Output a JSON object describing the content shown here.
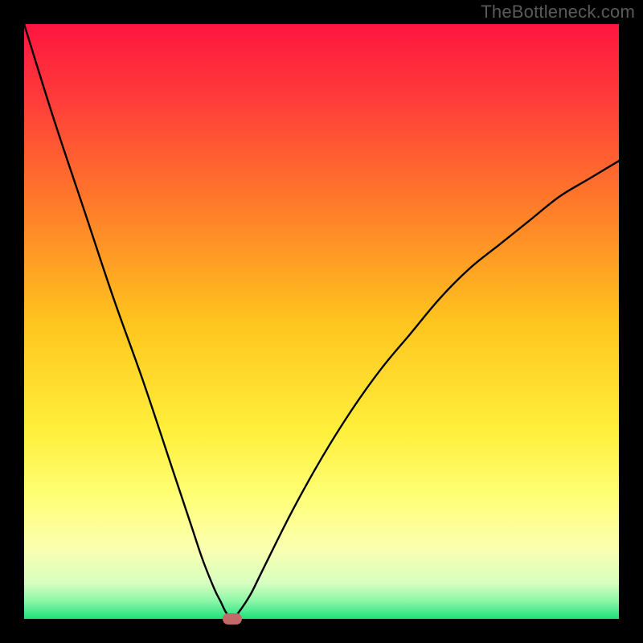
{
  "watermark": "TheBottleneck.com",
  "chart_data": {
    "type": "line",
    "title": "",
    "xlabel": "",
    "ylabel": "",
    "xlim": [
      0,
      100
    ],
    "ylim": [
      0,
      100
    ],
    "grid": false,
    "legend": false,
    "gradient_colors": [
      "#ff1a3e",
      "#ff6a2d",
      "#ffd21e",
      "#ffff66",
      "#f4ffc8",
      "#24e27e"
    ],
    "series": [
      {
        "name": "bottleneck-curve",
        "x": [
          0,
          5,
          10,
          15,
          20,
          25,
          28,
          30,
          32,
          33,
          34,
          35,
          36,
          38,
          40,
          45,
          50,
          55,
          60,
          65,
          70,
          75,
          80,
          85,
          90,
          95,
          100
        ],
        "y": [
          100,
          84,
          69,
          54,
          40,
          25,
          16,
          10,
          5,
          3,
          1,
          0,
          1,
          4,
          8,
          18,
          27,
          35,
          42,
          48,
          54,
          59,
          63,
          67,
          71,
          74,
          77
        ]
      }
    ],
    "marker": {
      "x": 35,
      "y": 0,
      "label": "optimal-point"
    }
  }
}
